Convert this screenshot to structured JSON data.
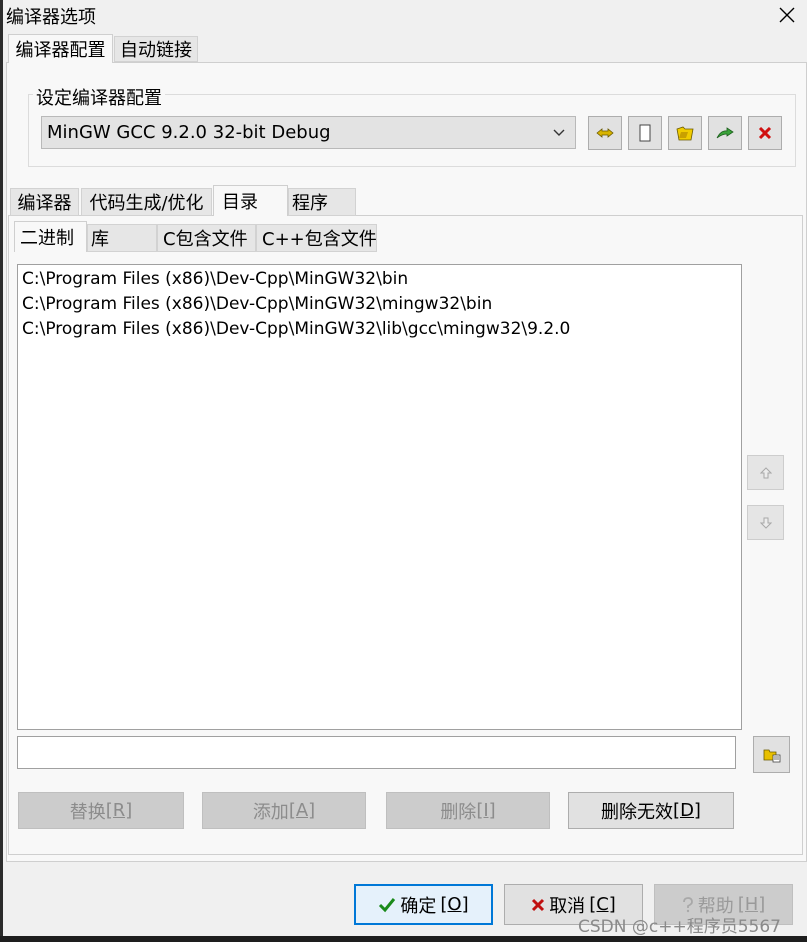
{
  "window": {
    "title": "编译器选项"
  },
  "top_tabs": [
    {
      "label": "编译器配置",
      "active": true
    },
    {
      "label": "自动链接",
      "active": false
    }
  ],
  "config_group": {
    "label": "设定编译器配置",
    "selected": "MinGW GCC 9.2.0 32-bit Debug",
    "tool_icons": [
      "rename-icon",
      "new-blank-icon",
      "folder-icon",
      "export-icon",
      "delete-icon"
    ]
  },
  "sub_tabs": [
    {
      "label": "编译器",
      "active": false
    },
    {
      "label": "代码生成/优化",
      "active": false
    },
    {
      "label": "目录",
      "active": true
    },
    {
      "label": "程序",
      "active": false
    }
  ],
  "dir_tabs": [
    {
      "label": "二进制",
      "active": true
    },
    {
      "label": "库",
      "active": false
    },
    {
      "label": "C包含文件",
      "active": false
    },
    {
      "label": "C++包含文件",
      "active": false
    }
  ],
  "dir_list": [
    "C:\\Program Files (x86)\\Dev-Cpp\\MinGW32\\bin",
    "C:\\Program Files (x86)\\Dev-Cpp\\MinGW32\\mingw32\\bin",
    "C:\\Program Files (x86)\\Dev-Cpp\\MinGW32\\lib\\gcc\\mingw32\\9.2.0"
  ],
  "path_input": {
    "value": ""
  },
  "actions": {
    "replace": {
      "label": "替换",
      "key": "[R]"
    },
    "add": {
      "label": "添加",
      "key": "[A]"
    },
    "delete": {
      "label": "删除",
      "key": "[I]"
    },
    "delete_invalid": {
      "label": "删除无效",
      "key": "[D]"
    }
  },
  "dialog_buttons": {
    "ok": {
      "label": "确定",
      "key": "[O]"
    },
    "cancel": {
      "label": "取消",
      "key": "[C]"
    },
    "help": {
      "label": "帮助",
      "key": "[H]"
    }
  },
  "watermark": "CSDN @c++程序员5567",
  "colors": {
    "accent": "#0078d7",
    "check": "#1a8a1a",
    "cancel_x": "#c01010",
    "folder": "#e8c000"
  }
}
